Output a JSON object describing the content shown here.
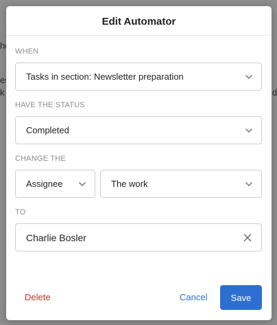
{
  "backdrop": {
    "fragments": [
      "he",
      "es",
      "k",
      "d"
    ]
  },
  "modal": {
    "title": "Edit Automator",
    "when": {
      "label": "WHEN",
      "value": "Tasks in section: Newsletter preparation"
    },
    "status": {
      "label": "HAVE THE STATUS",
      "value": "Completed"
    },
    "change": {
      "label": "CHANGE THE",
      "field_value": "Assignee",
      "target_value": "The work"
    },
    "to": {
      "label": "TO",
      "value": "Charlie Bosler"
    },
    "footer": {
      "delete_label": "Delete",
      "cancel_label": "Cancel",
      "save_label": "Save"
    }
  },
  "colors": {
    "primary": "#2d6fd1",
    "danger": "#d52a2a"
  },
  "icons": {
    "chevron": "chevron-down-icon",
    "clear": "close-icon"
  }
}
